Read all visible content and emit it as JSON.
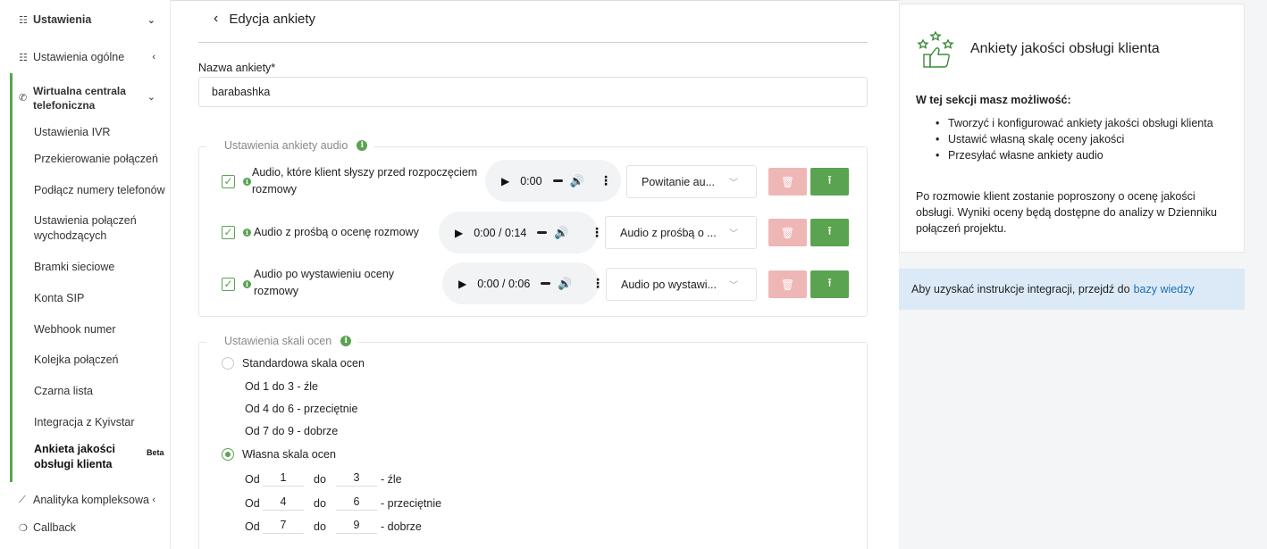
{
  "sidebar": {
    "settings": "Ustawienia",
    "general": "Ustawienia ogólne",
    "virtual_pbx": "Wirtualna centrala telefoniczna",
    "items": [
      "Ustawienia IVR",
      "Przekierowanie połączeń",
      "Podłącz numery telefonów",
      "Ustawienia połączeń wychodzących",
      "Bramki sieciowe",
      "Konta SIP",
      "Webhook numer",
      "Kolejka połączeń",
      "Czarna lista",
      "Integracja z Kyivstar",
      "Ankieta jakości obsługi klienta"
    ],
    "beta": "Beta",
    "analytics": "Analityka kompleksowa",
    "callback": "Callback"
  },
  "header": {
    "title": "Edycja ankiety"
  },
  "survey_name": {
    "label": "Nazwa ankiety*",
    "value": "barabashka"
  },
  "audio_settings": {
    "legend": "Ustawienia ankiety audio",
    "rows": [
      {
        "label": "Audio, które klient słyszy przed rozpoczęciem rozmowy",
        "time": "0:00",
        "select": "Powitanie au...",
        "checked": true
      },
      {
        "label": "Audio z prośbą o ocenę rozmowy",
        "time": "0:00 / 0:14",
        "select": "Audio z prośbą o ...",
        "checked": true
      },
      {
        "label": "Audio po wystawieniu oceny rozmowy",
        "time": "0:00 / 0:06",
        "select": "Audio po wystawi...",
        "checked": true
      }
    ]
  },
  "scale_settings": {
    "legend": "Ustawienia skali ocen",
    "standard": {
      "label": "Standardowa skala ocen",
      "lines": [
        "Od 1 do 3 - źle",
        "Od 4 do 6 - przeciętnie",
        "Od 7 do 9 - dobrze"
      ],
      "selected": false
    },
    "custom": {
      "label": "Własna skala ocen",
      "selected": true,
      "od": "Od",
      "do": "do",
      "rows": [
        {
          "from": "1",
          "to": "3",
          "desc": "- źle"
        },
        {
          "from": "4",
          "to": "6",
          "desc": "- przeciętnie"
        },
        {
          "from": "7",
          "to": "9",
          "desc": "- dobrze"
        }
      ]
    }
  },
  "info_panel": {
    "title": "Ankiety jakości obsługi klienta",
    "subtitle": "W tej sekcji masz możliwość:",
    "bullets": [
      "Tworzyć i konfigurować ankiety jakości obsługi klienta",
      "Ustawić własną skalę oceny jakości",
      "Przesyłać własne ankiety audio"
    ],
    "paragraph": "Po rozmowie klient zostanie poproszony o ocenę jakości obsługi. Wyniki oceny będą dostępne do analizy w Dzienniku połączeń projektu."
  },
  "kb_box": {
    "text": "Aby uzyskać instrukcje integracji, przejdź do",
    "link": "bazy wiedzy"
  },
  "colors": {
    "accent": "#5aa351",
    "delete": "#efb6b6",
    "link": "#1b6fb5",
    "kb_bg": "#dceaf7"
  }
}
